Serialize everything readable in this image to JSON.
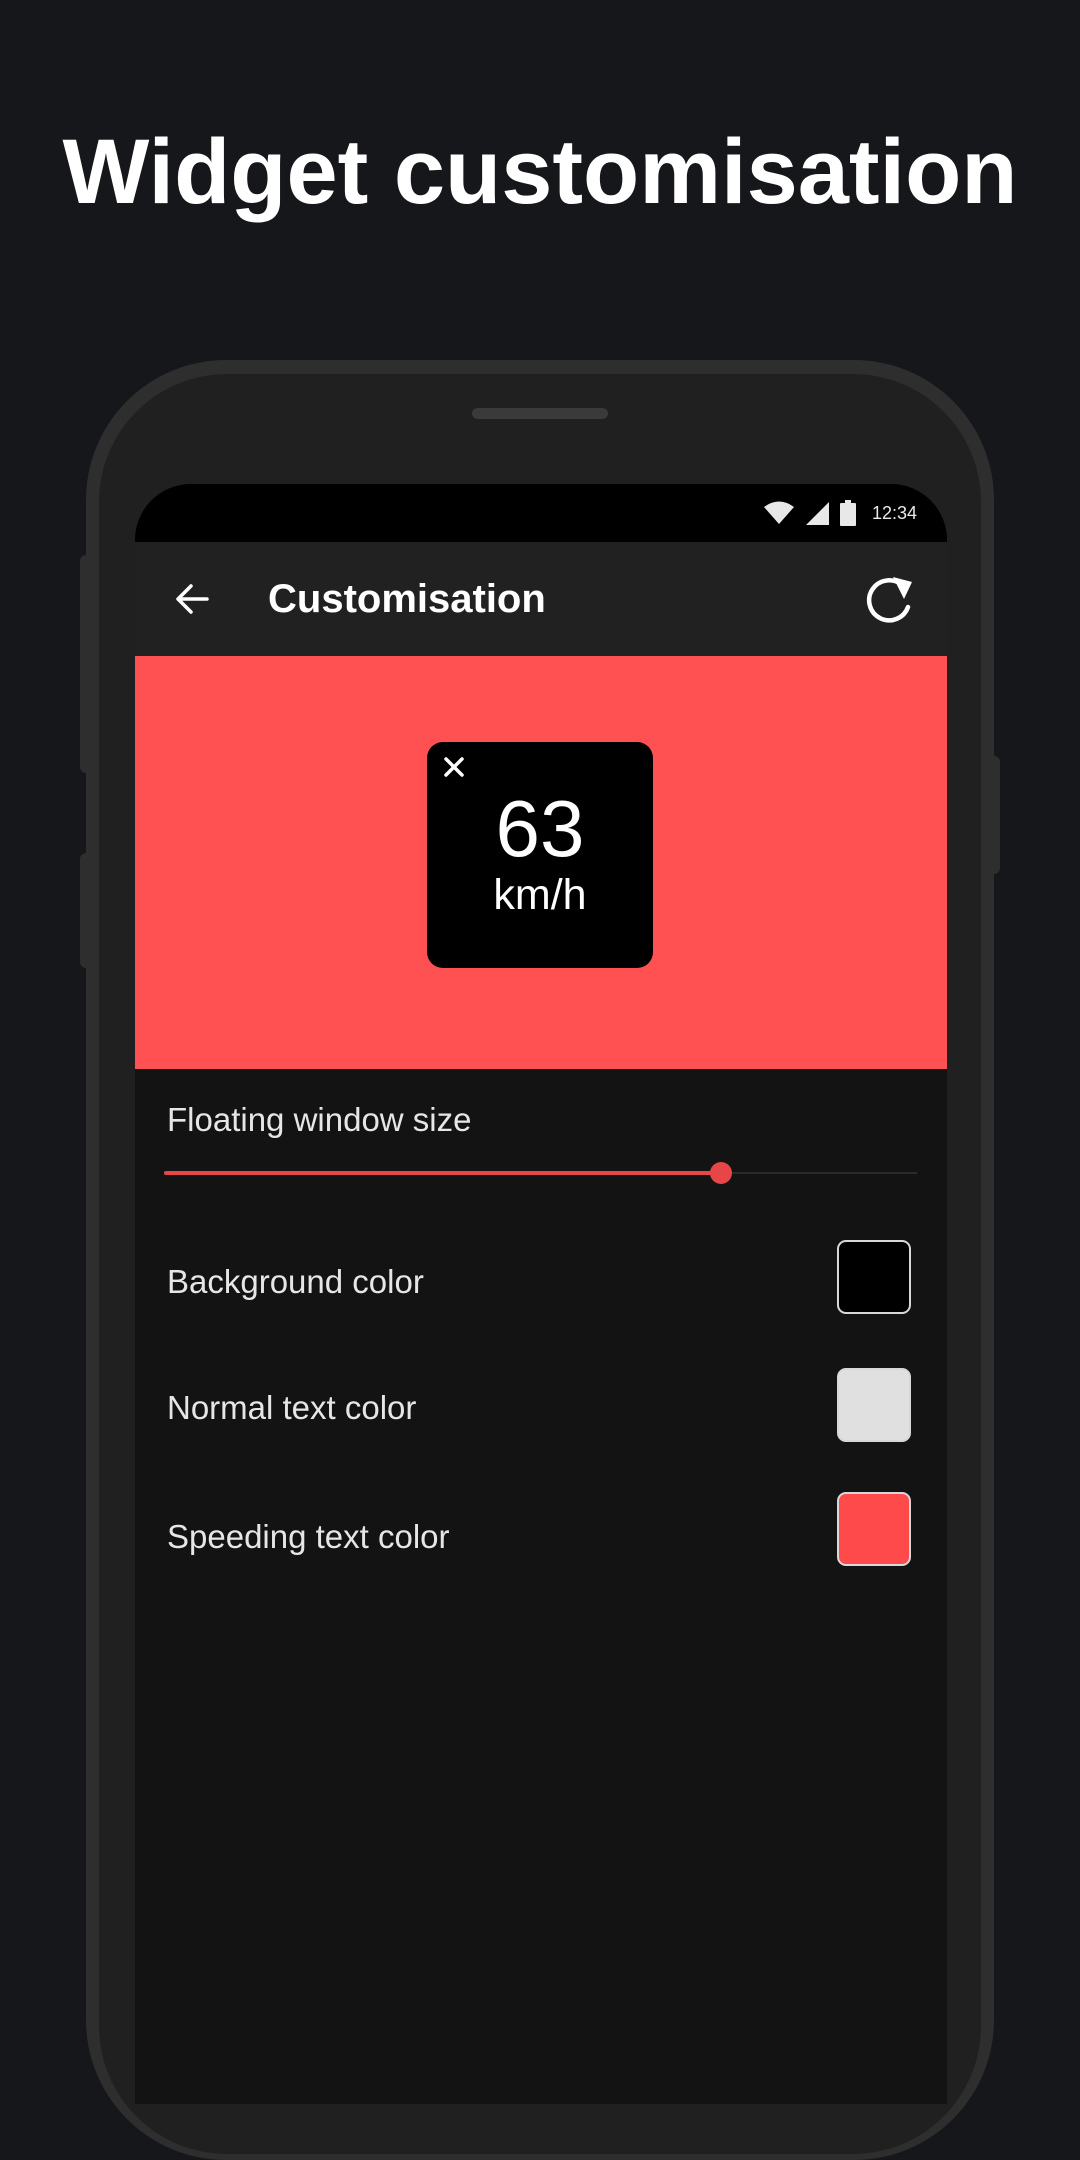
{
  "headline": "Widget customisation",
  "status_bar": {
    "time": "12:34"
  },
  "app_bar": {
    "title": "Customisation",
    "back_icon": "arrow-left-icon",
    "reset_icon": "refresh-icon"
  },
  "preview": {
    "background_color": "#ff5052",
    "widget": {
      "speed": "63",
      "unit": "km/h",
      "close_icon": "close-icon",
      "background_color": "#000000",
      "text_color": "#ffffff"
    }
  },
  "settings": {
    "size_label": "Floating window size",
    "size_value": 0.74,
    "accent_color": "#e84646",
    "colors": [
      {
        "label": "Background color",
        "value": "#000000"
      },
      {
        "label": "Normal text color",
        "value": "#e0e0e0"
      },
      {
        "label": "Speeding text color",
        "value": "#ff4a4c"
      }
    ]
  }
}
